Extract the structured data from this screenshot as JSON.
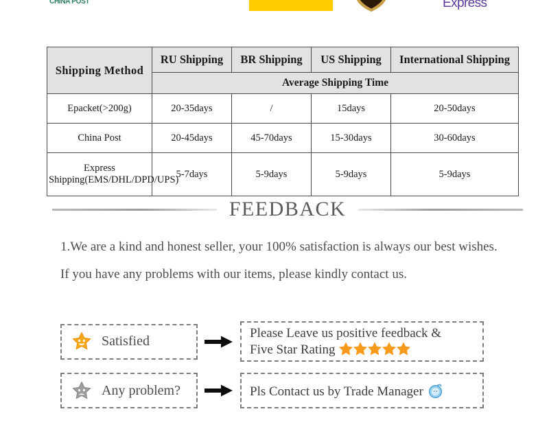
{
  "logos": {
    "china_post": "CHINA POST",
    "dhl": "dhl-logo",
    "ups": "ups-shield-logo",
    "fedex": "Express"
  },
  "shipping_table": {
    "headers": [
      "Shipping  Method",
      "RU Shipping",
      "BR Shipping",
      "US Shipping",
      "International Shipping"
    ],
    "subheader": "Average Shipping Time",
    "rows": [
      {
        "method": "Epacket(>200g)",
        "ru": "20-35days",
        "br": "/",
        "us": "15days",
        "intl": "20-50days"
      },
      {
        "method": "China Post",
        "ru": "20-45days",
        "br": "45-70days",
        "us": "15-30days",
        "intl": "30-60days"
      },
      {
        "method": "Express Shipping(EMS/DHL/DPD/UPS)",
        "ru": "5-7days",
        "br": "5-9days",
        "us": "5-9days",
        "intl": "5-9days"
      }
    ]
  },
  "feedback": {
    "title": "FEEDBACK",
    "paragraph": "1.We are a kind and honest seller, your 100% satisfaction is always our best wishes. If you have any problems with our items, please kindly contact us.",
    "rows": [
      {
        "left_label": "Satisfied",
        "left_icon": "smiling-star-icon",
        "arrow_icon": "right-arrow-icon",
        "right_line1": "Please Leave us positive feedback &",
        "right_line2": "Five Star Rating",
        "right_icon": "five-stars-icon",
        "star_count": 5
      },
      {
        "left_label": "Any problem?",
        "left_icon": "sad-star-icon",
        "arrow_icon": "right-arrow-icon",
        "right_line1": "Pls Contact us by Trade Manager",
        "right_line2": "",
        "right_icon": "trade-manager-icon",
        "star_count": 0
      }
    ]
  },
  "colors": {
    "star_orange": "#F59A23",
    "star_gray": "#9e9e9e",
    "dhl_yellow": "#FFCC00",
    "fedex_purple": "#5C3C9B",
    "china_post_green": "#2e7d63",
    "trade_manager_blue": "#4a9fd4",
    "table_header_bg": "#e2e2e2",
    "table_border": "#4a4a4a"
  }
}
